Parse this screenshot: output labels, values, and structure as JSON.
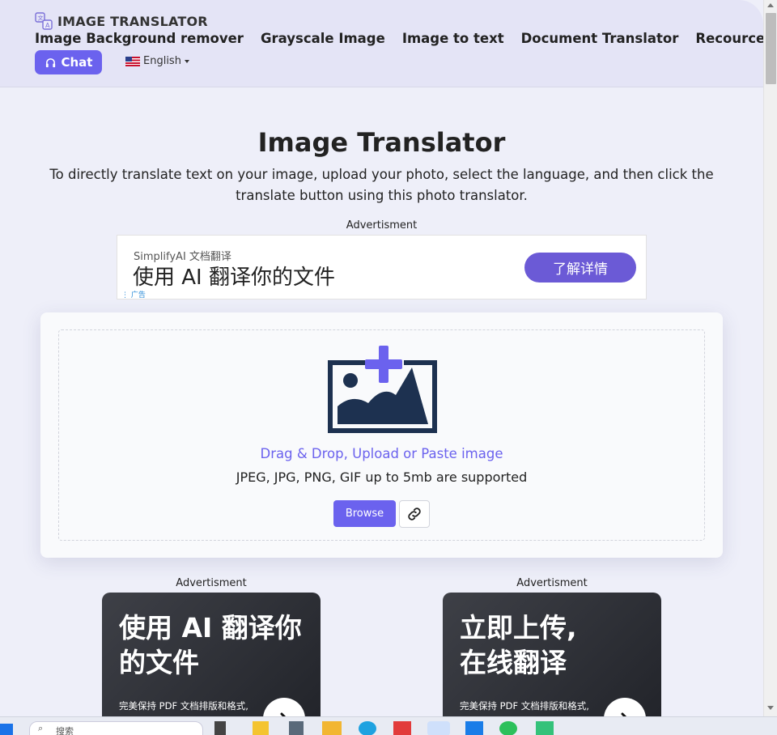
{
  "header": {
    "logo_text": "IMAGE TRANSLATOR",
    "nav": [
      {
        "label": "Image Background remover"
      },
      {
        "label": "Grayscale Image"
      },
      {
        "label": "Image to text"
      },
      {
        "label": "Document Translator"
      },
      {
        "label": "Recources"
      }
    ],
    "chat_label": "Chat",
    "language_label": "English"
  },
  "main": {
    "title": "Image Translator",
    "subtitle": "To directly translate text on your image, upload your photo, select the language, and then click the translate button using this photo translator."
  },
  "ad_top": {
    "label": "Advertisment",
    "brand": "SimplifyAI 文档翻译",
    "headline": "使用 AI 翻译你的文件",
    "cta": "了解详情",
    "mark": "广告"
  },
  "upload": {
    "drop_text": "Drag & Drop, Upload or Paste image",
    "support_text": "JPEG, JPG, PNG, GIF up to 5mb are supported",
    "browse_label": "Browse"
  },
  "ad_left": {
    "label": "Advertisment",
    "title": "使用 AI 翻译你的文件",
    "sub": "完美保持 PDF 文档排版和格式,"
  },
  "ad_right": {
    "label": "Advertisment",
    "title": "立即上传,在线翻译",
    "sub": "完美保持 PDF 文档排版和格式,"
  },
  "taskbar": {
    "search_placeholder": "搜索"
  },
  "colors": {
    "accent": "#6b62ee",
    "header_bg": "#e4e4f6",
    "page_bg": "#eeeff9",
    "icon_navy": "#1d3150"
  }
}
